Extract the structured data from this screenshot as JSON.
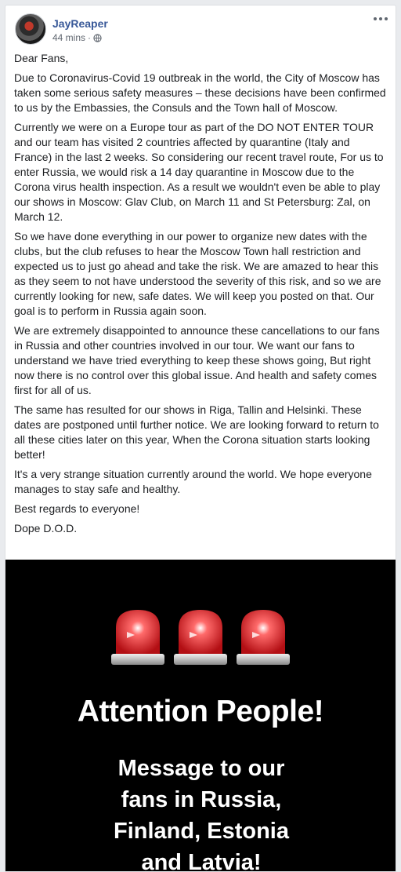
{
  "post": {
    "author": "JayReaper",
    "time": "44 mins",
    "separator": "·",
    "privacy_icon": "globe-icon",
    "menu_icon": "more-horizontal-icon",
    "paragraphs": [
      "Dear Fans,",
      "Due to Coronavirus-Covid 19 outbreak in the world, the City of Moscow has taken some serious safety measures – these decisions have been confirmed to us by the Embassies, the Consuls and the Town hall of Moscow.",
      "Currently we were on a Europe tour as part of the DO NOT ENTER TOUR and our team has visited 2 countries affected by quarantine (Italy and France) in the last 2 weeks. So considering our recent travel route, For us to enter Russia, we would risk a 14 day quarantine in Moscow due to the Corona virus health inspection. As a result we wouldn't even be able to play our shows in Moscow: Glav Club, on March 11 and St Petersburg: Zal, on March 12.",
      "So we have done everything in our power to organize new dates with the clubs, but the club refuses to hear the Moscow Town hall restriction and expected us to just go ahead and take the risk. We are amazed to hear this as they seem to not have understood the severity of this risk, and so we are currently looking for new, safe dates. We will keep you posted on that. Our goal is to perform in Russia again soon.",
      "We are extremely disappointed to announce these cancellations to our fans in Russia and other countries involved in our tour. We want our fans to understand we have tried everything to keep these shows going, But right now there is no control over this global issue. And health and safety comes first for all of us.",
      "The same has resulted for our shows in Riga, Tallin and Helsinki. These dates are postponed until further notice. We are looking forward to return to all these cities later on this year, When the Corona situation starts looking better!",
      "It's a very strange situation currently around the world. We hope everyone manages to stay safe and healthy.",
      "Best regards to everyone!",
      "Dope D.O.D."
    ]
  },
  "image": {
    "headline": "Attention People!",
    "subline_lines": [
      "Message to our",
      "fans in Russia,",
      "Finland, Estonia",
      "and Latvia!"
    ],
    "siren_icon": "siren-icon",
    "colors": {
      "background": "#000000",
      "text": "#ffffff",
      "siren": "#d7191f"
    }
  }
}
